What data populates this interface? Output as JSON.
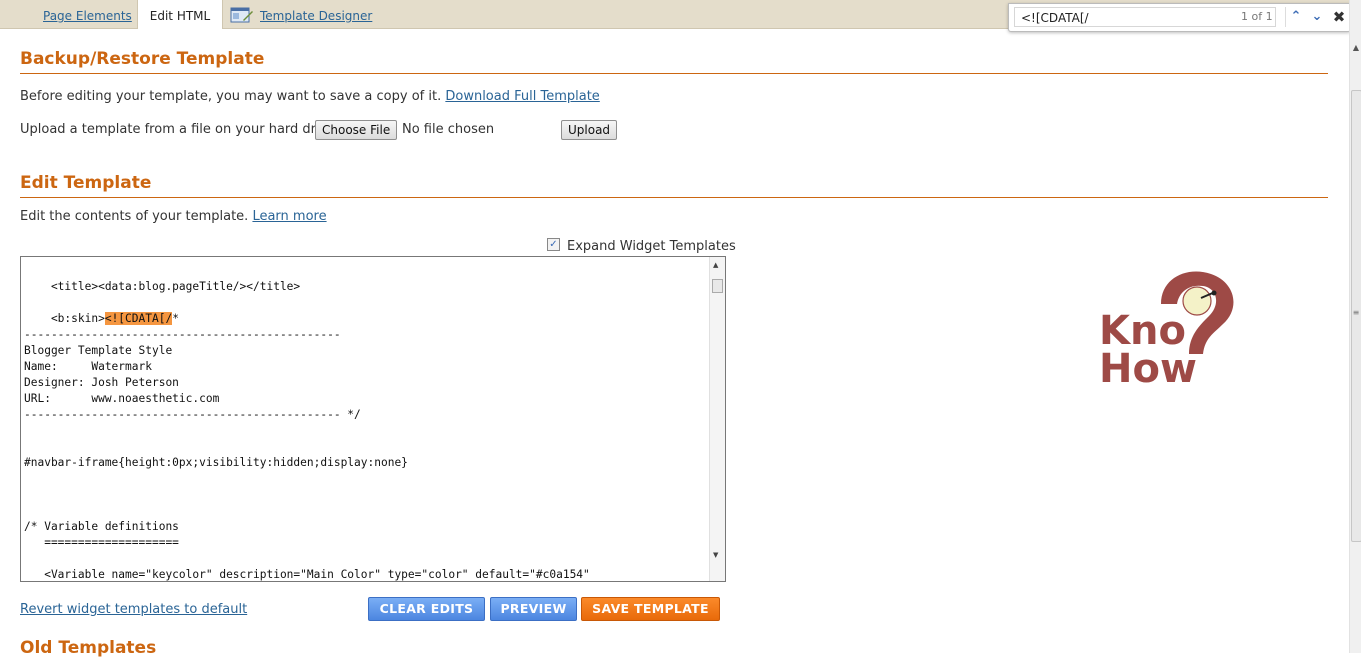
{
  "tabs": {
    "page_elements": "Page Elements",
    "edit_html": "Edit HTML",
    "template_designer": "Template Designer"
  },
  "find": {
    "query": "<![CDATA[/",
    "count": "1 of 1"
  },
  "backup": {
    "heading": "Backup/Restore Template",
    "intro": "Before editing your template, you may want to save a copy of it.",
    "download_link": "Download Full Template",
    "upload_label": "Upload a template from a file on your hard drive:",
    "choose_file": "Choose File",
    "no_file": "No file chosen",
    "upload_button": "Upload"
  },
  "edit": {
    "heading": "Edit Template",
    "intro": "Edit the contents of your template.",
    "learn_more": "Learn more",
    "expand_label": "Expand Widget Templates",
    "expand_checked": true,
    "code_lines": [
      "    <title><data:blog.pageTitle/></title>",
      "",
      "    <b:skin>",
      "-----------------------------------------------",
      "Blogger Template Style",
      "Name:     Watermark",
      "Designer: Josh Peterson",
      "URL:      www.noaesthetic.com",
      "----------------------------------------------- */",
      "",
      "",
      "#navbar-iframe{height:0px;visibility:hidden;display:none}",
      "",
      "",
      "",
      "/* Variable definitions",
      "   ====================",
      "",
      "   <Variable name=\"keycolor\" description=\"Main Color\" type=\"color\" default=\"#c0a154\""
    ],
    "highlight": "<![CDATA[/",
    "after_highlight": "*",
    "revert_link": "Revert widget templates to default",
    "clear_edits": "CLEAR EDITS",
    "preview": "PREVIEW",
    "save_template": "SAVE TEMPLATE"
  },
  "old": {
    "heading": "Old Templates"
  },
  "logo": {
    "line1": "Kno",
    "line2": "How",
    "color": "#9e4a46"
  },
  "colors": {
    "accent": "#cc6611",
    "link": "#2a6496",
    "blue_button": "#4c86e0",
    "orange_button": "#e86a0a"
  }
}
